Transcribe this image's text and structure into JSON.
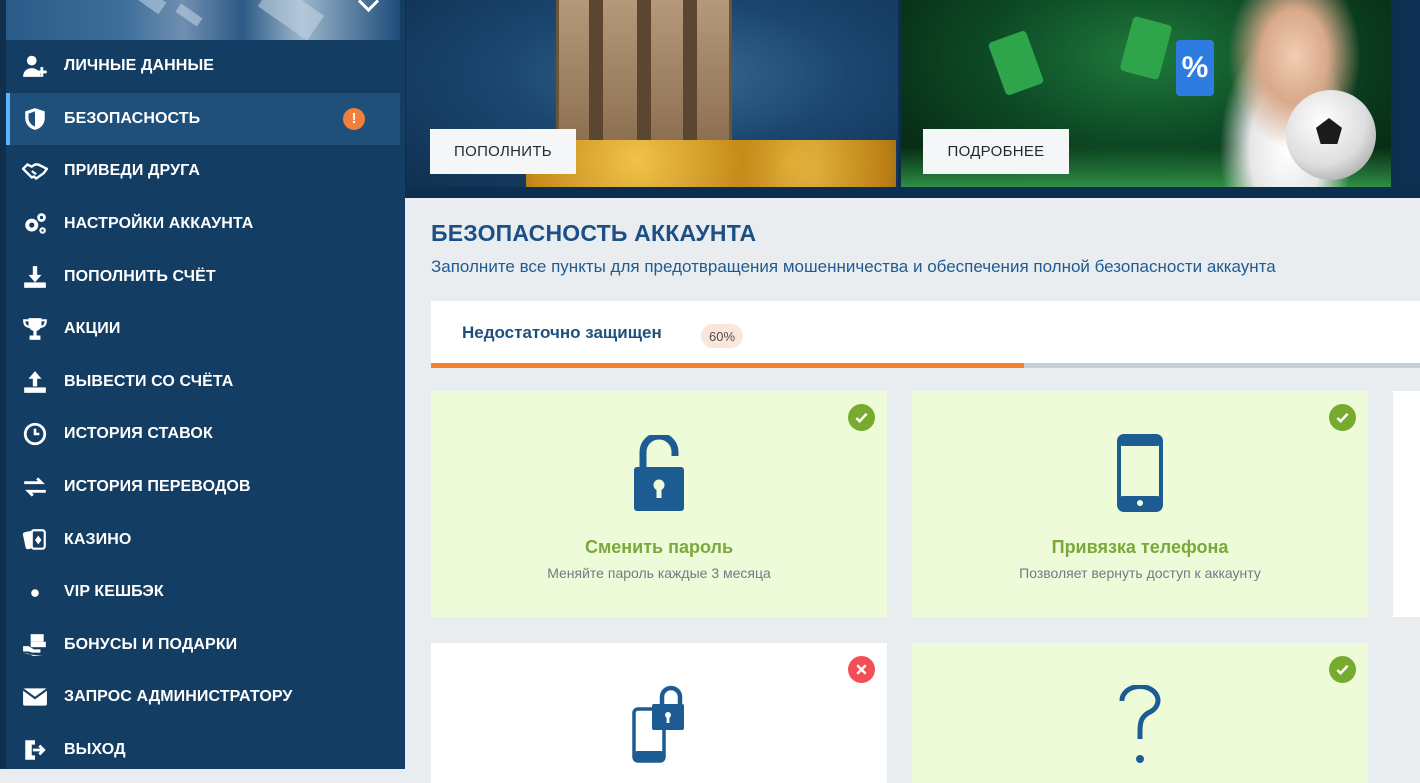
{
  "sidebar": {
    "items": [
      {
        "label": "ЛИЧНЫЕ ДАННЫЕ",
        "icon": "user-plus-icon"
      },
      {
        "label": "БЕЗОПАСНОСТЬ",
        "icon": "shield-icon",
        "badge": "!"
      },
      {
        "label": "ПРИВЕДИ ДРУГА",
        "icon": "handshake-icon"
      },
      {
        "label": "НАСТРОЙКИ АККАУНТА",
        "icon": "gears-icon"
      },
      {
        "label": "ПОПОЛНИТЬ СЧЁТ",
        "icon": "deposit-icon"
      },
      {
        "label": "АКЦИИ",
        "icon": "trophy-icon"
      },
      {
        "label": "ВЫВЕСТИ СО СЧЁТА",
        "icon": "withdraw-icon"
      },
      {
        "label": "ИСТОРИЯ СТАВОК",
        "icon": "clock-icon"
      },
      {
        "label": "ИСТОРИЯ ПЕРЕВОДОВ",
        "icon": "transfer-arrows-icon"
      },
      {
        "label": "КАЗИНО",
        "icon": "cards-icon"
      },
      {
        "label": "VIP КЕШБЭК",
        "icon": "dot-icon"
      },
      {
        "label": "БОНУСЫ И ПОДАРКИ",
        "icon": "gift-icon"
      },
      {
        "label": "ЗАПРОС АДМИНИСТРАТОРУ",
        "icon": "envelope-icon"
      },
      {
        "label": "ВЫХОД",
        "icon": "logout-icon"
      }
    ]
  },
  "banners": {
    "deposit_button": "ПОПОЛНИТЬ",
    "details_button": "ПОДРОБНЕЕ",
    "percent_card": "%"
  },
  "security": {
    "title": "БЕЗОПАСНОСТЬ АККАУНТА",
    "subtitle": "Заполните все пункты для предотвращения мошенничества и обеспечения полной безопасности аккаунта",
    "status_text": "Недостаточно защищен",
    "percent_label": "60%",
    "progress": 0.6,
    "cards": [
      {
        "title": "Сменить пароль",
        "desc": "Меняйте пароль каждые 3 месяца",
        "status": "done",
        "icon": "padlock-icon"
      },
      {
        "title": "Привязка телефона",
        "desc": "Позволяет вернуть доступ к аккаунту",
        "status": "done",
        "icon": "smartphone-icon"
      },
      {
        "title": "",
        "desc": "",
        "status": "missing",
        "icon": "phone-lock-icon"
      },
      {
        "title": "",
        "desc": "",
        "status": "done",
        "icon": "question-mark-icon"
      }
    ]
  },
  "colors": {
    "sidebar_bg": "#133d63",
    "accent_orange": "#f5812f",
    "title_blue": "#1b4f86",
    "card_done_bg": "#eefbd9",
    "ok_green": "#77ab2e",
    "error_red": "#ef4f55"
  }
}
